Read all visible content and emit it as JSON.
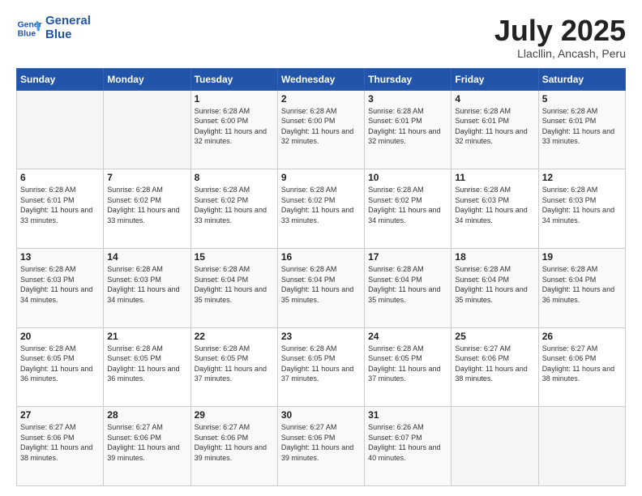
{
  "header": {
    "logo_line1": "General",
    "logo_line2": "Blue",
    "month": "July 2025",
    "location": "Llacllin, Ancash, Peru"
  },
  "weekdays": [
    "Sunday",
    "Monday",
    "Tuesday",
    "Wednesday",
    "Thursday",
    "Friday",
    "Saturday"
  ],
  "weeks": [
    [
      {
        "day": "",
        "sunrise": "",
        "sunset": "",
        "daylight": ""
      },
      {
        "day": "",
        "sunrise": "",
        "sunset": "",
        "daylight": ""
      },
      {
        "day": "1",
        "sunrise": "Sunrise: 6:28 AM",
        "sunset": "Sunset: 6:00 PM",
        "daylight": "Daylight: 11 hours and 32 minutes."
      },
      {
        "day": "2",
        "sunrise": "Sunrise: 6:28 AM",
        "sunset": "Sunset: 6:00 PM",
        "daylight": "Daylight: 11 hours and 32 minutes."
      },
      {
        "day": "3",
        "sunrise": "Sunrise: 6:28 AM",
        "sunset": "Sunset: 6:01 PM",
        "daylight": "Daylight: 11 hours and 32 minutes."
      },
      {
        "day": "4",
        "sunrise": "Sunrise: 6:28 AM",
        "sunset": "Sunset: 6:01 PM",
        "daylight": "Daylight: 11 hours and 32 minutes."
      },
      {
        "day": "5",
        "sunrise": "Sunrise: 6:28 AM",
        "sunset": "Sunset: 6:01 PM",
        "daylight": "Daylight: 11 hours and 33 minutes."
      }
    ],
    [
      {
        "day": "6",
        "sunrise": "Sunrise: 6:28 AM",
        "sunset": "Sunset: 6:01 PM",
        "daylight": "Daylight: 11 hours and 33 minutes."
      },
      {
        "day": "7",
        "sunrise": "Sunrise: 6:28 AM",
        "sunset": "Sunset: 6:02 PM",
        "daylight": "Daylight: 11 hours and 33 minutes."
      },
      {
        "day": "8",
        "sunrise": "Sunrise: 6:28 AM",
        "sunset": "Sunset: 6:02 PM",
        "daylight": "Daylight: 11 hours and 33 minutes."
      },
      {
        "day": "9",
        "sunrise": "Sunrise: 6:28 AM",
        "sunset": "Sunset: 6:02 PM",
        "daylight": "Daylight: 11 hours and 33 minutes."
      },
      {
        "day": "10",
        "sunrise": "Sunrise: 6:28 AM",
        "sunset": "Sunset: 6:02 PM",
        "daylight": "Daylight: 11 hours and 34 minutes."
      },
      {
        "day": "11",
        "sunrise": "Sunrise: 6:28 AM",
        "sunset": "Sunset: 6:03 PM",
        "daylight": "Daylight: 11 hours and 34 minutes."
      },
      {
        "day": "12",
        "sunrise": "Sunrise: 6:28 AM",
        "sunset": "Sunset: 6:03 PM",
        "daylight": "Daylight: 11 hours and 34 minutes."
      }
    ],
    [
      {
        "day": "13",
        "sunrise": "Sunrise: 6:28 AM",
        "sunset": "Sunset: 6:03 PM",
        "daylight": "Daylight: 11 hours and 34 minutes."
      },
      {
        "day": "14",
        "sunrise": "Sunrise: 6:28 AM",
        "sunset": "Sunset: 6:03 PM",
        "daylight": "Daylight: 11 hours and 34 minutes."
      },
      {
        "day": "15",
        "sunrise": "Sunrise: 6:28 AM",
        "sunset": "Sunset: 6:04 PM",
        "daylight": "Daylight: 11 hours and 35 minutes."
      },
      {
        "day": "16",
        "sunrise": "Sunrise: 6:28 AM",
        "sunset": "Sunset: 6:04 PM",
        "daylight": "Daylight: 11 hours and 35 minutes."
      },
      {
        "day": "17",
        "sunrise": "Sunrise: 6:28 AM",
        "sunset": "Sunset: 6:04 PM",
        "daylight": "Daylight: 11 hours and 35 minutes."
      },
      {
        "day": "18",
        "sunrise": "Sunrise: 6:28 AM",
        "sunset": "Sunset: 6:04 PM",
        "daylight": "Daylight: 11 hours and 35 minutes."
      },
      {
        "day": "19",
        "sunrise": "Sunrise: 6:28 AM",
        "sunset": "Sunset: 6:04 PM",
        "daylight": "Daylight: 11 hours and 36 minutes."
      }
    ],
    [
      {
        "day": "20",
        "sunrise": "Sunrise: 6:28 AM",
        "sunset": "Sunset: 6:05 PM",
        "daylight": "Daylight: 11 hours and 36 minutes."
      },
      {
        "day": "21",
        "sunrise": "Sunrise: 6:28 AM",
        "sunset": "Sunset: 6:05 PM",
        "daylight": "Daylight: 11 hours and 36 minutes."
      },
      {
        "day": "22",
        "sunrise": "Sunrise: 6:28 AM",
        "sunset": "Sunset: 6:05 PM",
        "daylight": "Daylight: 11 hours and 37 minutes."
      },
      {
        "day": "23",
        "sunrise": "Sunrise: 6:28 AM",
        "sunset": "Sunset: 6:05 PM",
        "daylight": "Daylight: 11 hours and 37 minutes."
      },
      {
        "day": "24",
        "sunrise": "Sunrise: 6:28 AM",
        "sunset": "Sunset: 6:05 PM",
        "daylight": "Daylight: 11 hours and 37 minutes."
      },
      {
        "day": "25",
        "sunrise": "Sunrise: 6:27 AM",
        "sunset": "Sunset: 6:06 PM",
        "daylight": "Daylight: 11 hours and 38 minutes."
      },
      {
        "day": "26",
        "sunrise": "Sunrise: 6:27 AM",
        "sunset": "Sunset: 6:06 PM",
        "daylight": "Daylight: 11 hours and 38 minutes."
      }
    ],
    [
      {
        "day": "27",
        "sunrise": "Sunrise: 6:27 AM",
        "sunset": "Sunset: 6:06 PM",
        "daylight": "Daylight: 11 hours and 38 minutes."
      },
      {
        "day": "28",
        "sunrise": "Sunrise: 6:27 AM",
        "sunset": "Sunset: 6:06 PM",
        "daylight": "Daylight: 11 hours and 39 minutes."
      },
      {
        "day": "29",
        "sunrise": "Sunrise: 6:27 AM",
        "sunset": "Sunset: 6:06 PM",
        "daylight": "Daylight: 11 hours and 39 minutes."
      },
      {
        "day": "30",
        "sunrise": "Sunrise: 6:27 AM",
        "sunset": "Sunset: 6:06 PM",
        "daylight": "Daylight: 11 hours and 39 minutes."
      },
      {
        "day": "31",
        "sunrise": "Sunrise: 6:26 AM",
        "sunset": "Sunset: 6:07 PM",
        "daylight": "Daylight: 11 hours and 40 minutes."
      },
      {
        "day": "",
        "sunrise": "",
        "sunset": "",
        "daylight": ""
      },
      {
        "day": "",
        "sunrise": "",
        "sunset": "",
        "daylight": ""
      }
    ]
  ]
}
